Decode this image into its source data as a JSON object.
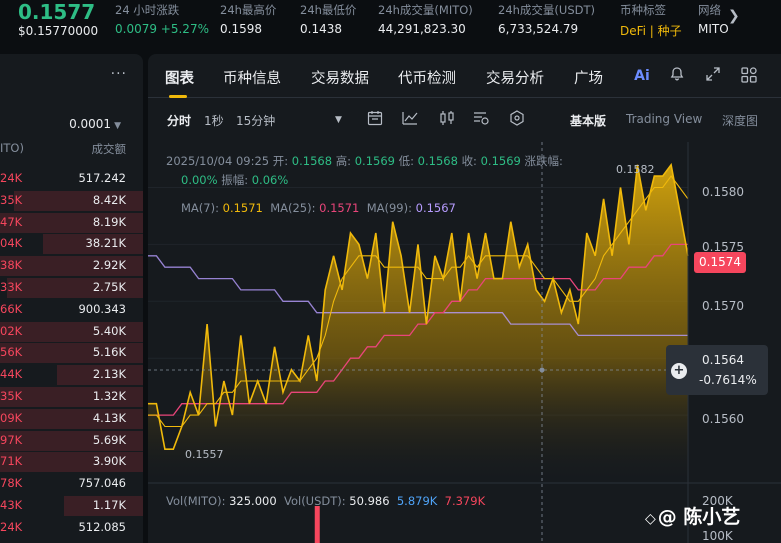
{
  "ticker": {
    "price": "0.1577",
    "price_usd": "$0.15770000",
    "stats": [
      {
        "label": "24 小时涨跌",
        "value": "0.0079 +5.27%",
        "color": "green"
      },
      {
        "label": "24h最高价",
        "value": "0.1598"
      },
      {
        "label": "24h最低价",
        "value": "0.1438"
      },
      {
        "label": "24h成交量(MITO)",
        "value": "44,291,823.30"
      },
      {
        "label": "24h成交量(USDT)",
        "value": "6,733,524.79"
      },
      {
        "label": "币种标签",
        "value": "DeFi | 种子",
        "color": "yellow"
      },
      {
        "label": "网络",
        "value": "MITO"
      }
    ]
  },
  "order_book": {
    "precision": "0.0001",
    "header_left": "ITO)",
    "header_right": "成交额",
    "rows": [
      {
        "price": "24K",
        "amount": "517.242",
        "bar": 0
      },
      {
        "price": "35K",
        "amount": "8.42K",
        "bar": 90
      },
      {
        "price": "47K",
        "amount": "8.19K",
        "bar": 100
      },
      {
        "price": "04K",
        "amount": "38.21K",
        "bar": 70
      },
      {
        "price": "38K",
        "amount": "2.92K",
        "bar": 100
      },
      {
        "price": "33K",
        "amount": "2.75K",
        "bar": 95
      },
      {
        "price": "66K",
        "amount": "900.343",
        "bar": 0
      },
      {
        "price": "02K",
        "amount": "5.40K",
        "bar": 100
      },
      {
        "price": "56K",
        "amount": "5.16K",
        "bar": 100
      },
      {
        "price": "44K",
        "amount": "2.13K",
        "bar": 60
      },
      {
        "price": "35K",
        "amount": "1.32K",
        "bar": 100
      },
      {
        "price": "09K",
        "amount": "4.13K",
        "bar": 100
      },
      {
        "price": "97K",
        "amount": "5.69K",
        "bar": 100
      },
      {
        "price": "71K",
        "amount": "3.90K",
        "bar": 100
      },
      {
        "price": "78K",
        "amount": "757.046",
        "bar": 0
      },
      {
        "price": "43K",
        "amount": "1.17K",
        "bar": 55
      },
      {
        "price": "24K",
        "amount": "512.085",
        "bar": 0
      }
    ]
  },
  "chart_tabs": [
    "图表",
    "币种信息",
    "交易数据",
    "代币检测",
    "交易分析",
    "广场"
  ],
  "icons": {
    "ai": "Ai",
    "bell": "bell-icon",
    "expand": "expand-icon",
    "grid": "grid-icon"
  },
  "toolbar": {
    "intervals": [
      "分时",
      "1秒",
      "15分钟"
    ],
    "views": [
      "基本版",
      "Trading View",
      "深度图"
    ]
  },
  "ohlc": {
    "datetime": "2025/10/04 09:25",
    "open_label": "开:",
    "open": "0.1568",
    "high_label": "高:",
    "high": "0.1569",
    "low_label": "低:",
    "low": "0.1568",
    "close_label": "收:",
    "close": "0.1569",
    "change_label": "涨跌幅:",
    "change": "0.00%",
    "amp_label": "振幅:",
    "amp": "0.06%"
  },
  "ma": {
    "ma7_label": "MA(7):",
    "ma7": "0.1571",
    "ma25_label": "MA(25):",
    "ma25": "0.1571",
    "ma99_label": "MA(99):",
    "ma99": "0.1567"
  },
  "y_axis": [
    "0.1580",
    "0.1575",
    "0.1570",
    "0.1560"
  ],
  "current_price_badge": "0.1574",
  "crosshair": {
    "price": "0.1564",
    "pct": "-0.7614%"
  },
  "annotations": {
    "high": "0.1582",
    "low": "0.1557"
  },
  "volume": {
    "label": "Vol(MITO):",
    "value": "325.000",
    "usdt_label": "Vol(USDT):",
    "usdt": "50.986",
    "v1": "5.879K",
    "v2": "7.379K",
    "axis": [
      "200K",
      "100K"
    ]
  },
  "watermark": "@ 陈小艺",
  "colors": {
    "green": "#2ebd85",
    "red": "#f6465d",
    "yellow": "#f0b90b",
    "pink": "#e9457a",
    "purple": "#b79cff"
  },
  "chart_data": {
    "type": "area",
    "ylim": [
      0.1555,
      0.1584
    ],
    "price": [
      0.1561,
      0.1561,
      0.1557,
      0.1557,
      0.1559,
      0.1562,
      0.156,
      0.1568,
      0.1559,
      0.1563,
      0.156,
      0.1567,
      0.1561,
      0.1563,
      0.1561,
      0.1566,
      0.1562,
      0.1564,
      0.1563,
      0.1567,
      0.1563,
      0.1571,
      0.1574,
      0.1571,
      0.1576,
      0.1575,
      0.1572,
      0.1576,
      0.1569,
      0.1577,
      0.1574,
      0.1569,
      0.1575,
      0.1568,
      0.1574,
      0.1572,
      0.1576,
      0.157,
      0.1576,
      0.1572,
      0.1576,
      0.1572,
      0.1572,
      0.1577,
      0.1573,
      0.1575,
      0.1571,
      0.157,
      0.1572,
      0.1569,
      0.1571,
      0.1568,
      0.1576,
      0.1574,
      0.1579,
      0.1574,
      0.158,
      0.1575,
      0.1582,
      0.1578,
      0.1581,
      0.1581,
      0.1582,
      0.1578,
      0.1574
    ],
    "ma7": [
      0.156,
      0.156,
      0.1559,
      0.1559,
      0.1559,
      0.156,
      0.156,
      0.1561,
      0.1561,
      0.1562,
      0.1562,
      0.1563,
      0.1563,
      0.1563,
      0.1563,
      0.1563,
      0.1563,
      0.1563,
      0.1563,
      0.1564,
      0.1565,
      0.1567,
      0.157,
      0.1572,
      0.1573,
      0.1574,
      0.1574,
      0.1574,
      0.1573,
      0.1573,
      0.1573,
      0.1573,
      0.1573,
      0.1572,
      0.1572,
      0.1572,
      0.1573,
      0.1573,
      0.1574,
      0.1573,
      0.1574,
      0.1574,
      0.1574,
      0.1574,
      0.1574,
      0.1574,
      0.1573,
      0.1572,
      0.1572,
      0.1571,
      0.157,
      0.157,
      0.1571,
      0.1572,
      0.1574,
      0.1575,
      0.1576,
      0.1577,
      0.1578,
      0.1579,
      0.158,
      0.158,
      0.1581,
      0.158,
      0.1579
    ],
    "ma25": [
      0.156,
      0.156,
      0.156,
      0.156,
      0.1561,
      0.1561,
      0.1561,
      0.1561,
      0.1561,
      0.1561,
      0.1561,
      0.1561,
      0.1561,
      0.1561,
      0.1561,
      0.1561,
      0.1561,
      0.1562,
      0.1562,
      0.1562,
      0.1562,
      0.1563,
      0.1563,
      0.1564,
      0.1565,
      0.1565,
      0.1566,
      0.1566,
      0.1567,
      0.1567,
      0.1567,
      0.1567,
      0.1568,
      0.1568,
      0.1569,
      0.1569,
      0.157,
      0.157,
      0.1571,
      0.1571,
      0.1572,
      0.1572,
      0.1572,
      0.1572,
      0.1572,
      0.1572,
      0.1572,
      0.1572,
      0.1572,
      0.1572,
      0.1572,
      0.1571,
      0.1571,
      0.1571,
      0.1572,
      0.1572,
      0.1572,
      0.1573,
      0.1573,
      0.1573,
      0.1574,
      0.1574,
      0.1575,
      0.1575,
      0.1575
    ],
    "ma99": [
      0.1574,
      0.1574,
      0.1573,
      0.1573,
      0.1573,
      0.1573,
      0.1572,
      0.1572,
      0.1572,
      0.1572,
      0.1572,
      0.1571,
      0.1571,
      0.1571,
      0.1571,
      0.1571,
      0.157,
      0.157,
      0.157,
      0.157,
      0.1569,
      0.1569,
      0.1569,
      0.1569,
      0.1569,
      0.1569,
      0.1569,
      0.1569,
      0.1569,
      0.1569,
      0.1569,
      0.1569,
      0.1569,
      0.1569,
      0.1569,
      0.1569,
      0.1569,
      0.1569,
      0.1569,
      0.1569,
      0.1569,
      0.1569,
      0.1569,
      0.1568,
      0.1568,
      0.1568,
      0.1568,
      0.1568,
      0.1568,
      0.1568,
      0.1568,
      0.1567,
      0.1567,
      0.1567,
      0.1567,
      0.1567,
      0.1567,
      0.1567,
      0.1567,
      0.1567,
      0.1567,
      0.1567,
      0.1567,
      0.1567,
      0.1567
    ],
    "volume_bar": [
      0,
      0,
      0,
      0,
      0,
      0,
      0,
      0,
      0,
      0,
      0,
      0,
      0,
      0,
      0,
      0,
      0,
      0,
      0,
      0,
      1,
      0,
      0,
      0,
      0,
      0,
      0,
      0,
      0,
      0,
      0,
      0,
      0,
      0,
      0,
      0,
      0,
      0,
      0,
      0,
      0,
      0,
      0,
      0,
      0,
      0,
      0,
      0,
      0,
      0,
      0,
      0,
      0,
      0,
      0,
      0,
      0,
      0,
      0,
      0,
      0,
      0,
      0,
      0,
      0
    ]
  }
}
